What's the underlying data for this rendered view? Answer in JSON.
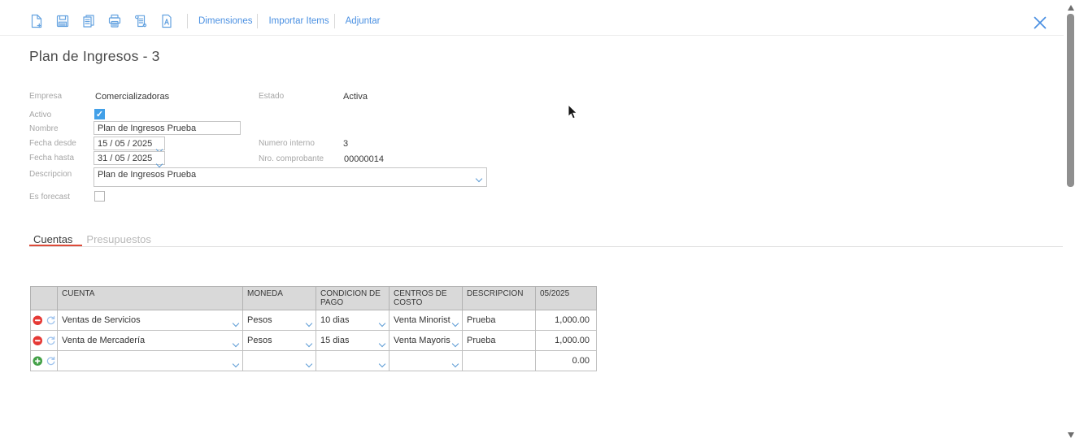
{
  "toolbar": {
    "icons": [
      {
        "name": "new-document"
      },
      {
        "name": "save"
      },
      {
        "name": "copy"
      },
      {
        "name": "print"
      },
      {
        "name": "journal"
      },
      {
        "name": "document-a"
      }
    ],
    "links": [
      {
        "label": "Dimensiones"
      },
      {
        "label": "Importar Items"
      },
      {
        "label": "Adjuntar"
      }
    ]
  },
  "page": {
    "title": "Plan de Ingresos - 3"
  },
  "form": {
    "empresa": {
      "label": "Empresa",
      "value": "Comercializadoras"
    },
    "estado": {
      "label": "Estado",
      "value": "Activa"
    },
    "activo": {
      "label": "Activo",
      "checked": true
    },
    "nombre": {
      "label": "Nombre",
      "value": "Plan de Ingresos Prueba"
    },
    "fecha_desde": {
      "label": "Fecha desde",
      "value": "15 / 05 /  2025"
    },
    "numero_interno": {
      "label": "Numero interno",
      "value": "3"
    },
    "fecha_hasta": {
      "label": "Fecha hasta",
      "value": "31 / 05 /  2025"
    },
    "nro_comprobante": {
      "label": "Nro. comprobante",
      "value": "00000014"
    },
    "descripcion": {
      "label": "Descripcion",
      "value": "Plan de Ingresos Prueba"
    },
    "es_forecast": {
      "label": "Es forecast",
      "checked": false
    }
  },
  "tabs": [
    {
      "label": "Cuentas",
      "active": true
    },
    {
      "label": "Presupuestos",
      "active": false
    }
  ],
  "grid": {
    "headers": {
      "actions": "",
      "cuenta": "CUENTA",
      "moneda": "MONEDA",
      "condicion_de_pago": "CONDICION DE PAGO",
      "centros_de_costo": "CENTROS DE COSTO",
      "descripcion": "DESCRIPCION",
      "period": "05/2025"
    },
    "rows": [
      {
        "cuenta": "Ventas de Servicios",
        "moneda": "Pesos",
        "condicion_de_pago": "10 dias",
        "centros_de_costo": "Venta Minorist",
        "descripcion": "Prueba",
        "amount": "1,000.00"
      },
      {
        "cuenta": "Venta de Mercadería",
        "moneda": "Pesos",
        "condicion_de_pago": "15 dias",
        "centros_de_costo": "Venta Mayoris",
        "descripcion": "Prueba",
        "amount": "1,000.00"
      },
      {
        "cuenta": "",
        "moneda": "",
        "condicion_de_pago": "",
        "centros_de_costo": "",
        "descripcion": "",
        "amount": "0.00"
      }
    ]
  },
  "colors": {
    "accent_blue": "#4a90e2",
    "icon_blue": "#64a2e0",
    "tab_underline_red": "#dd4b39",
    "delete_red": "#e53935",
    "add_green": "#43a047",
    "checkbox_blue": "#42a0e8",
    "grid_header_gray": "#d9d9d9"
  }
}
